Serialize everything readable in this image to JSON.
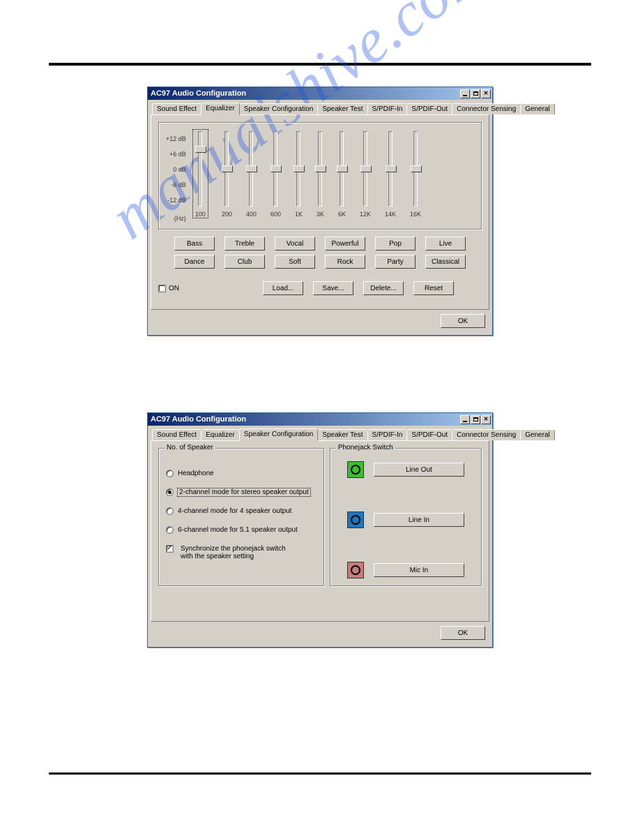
{
  "watermark": "manualshive.com",
  "window1": {
    "title": "AC97 Audio Configuration",
    "tabs": [
      "Sound Effect",
      "Equalizer",
      "Speaker Configuration",
      "Speaker Test",
      "S/PDIF-In",
      "S/PDIF-Out",
      "Connector Sensing",
      "General"
    ],
    "active_tab_index": 1,
    "eq_db_labels": [
      "+12 dB",
      "+6 dB",
      "0 dB",
      "-6 dB",
      "-12 dB"
    ],
    "eq_hz_label": "(Hz)",
    "eq_bands": [
      "100",
      "200",
      "400",
      "600",
      "1K",
      "3K",
      "6K",
      "12K",
      "14K",
      "16K"
    ],
    "presets_row1": [
      "Bass",
      "Treble",
      "Vocal",
      "Powerful",
      "Pop",
      "Live"
    ],
    "presets_row2": [
      "Dance",
      "Club",
      "Soft",
      "Rock",
      "Party",
      "Classical"
    ],
    "on_checkbox": "ON",
    "on_checked": false,
    "buttons_row3": [
      "Load...",
      "Save...",
      "Delete...",
      "Reset"
    ],
    "ok": "OK"
  },
  "window2": {
    "title": "AC97 Audio Configuration",
    "tabs": [
      "Sound Effect",
      "Equalizer",
      "Speaker Configuration",
      "Speaker Test",
      "S/PDIF-In",
      "S/PDIF-Out",
      "Connector Sensing",
      "General"
    ],
    "active_tab_index": 2,
    "group1": "No. of Speaker",
    "group2": "Phonejack Switch",
    "radios": [
      {
        "label": "Headphone",
        "checked": false
      },
      {
        "label": "2-channel mode for stereo speaker output",
        "checked": true
      },
      {
        "label": "4-channel mode for 4 speaker output",
        "checked": false
      },
      {
        "label": "6-channel mode for 5.1 speaker output",
        "checked": false
      }
    ],
    "sync_checkbox": "Synchronize the phonejack switch with the speaker setting",
    "sync_checked": true,
    "jacks": [
      {
        "color": "green",
        "label": "Line Out"
      },
      {
        "color": "blue",
        "label": "Line In"
      },
      {
        "color": "pink",
        "label": "Mic In"
      }
    ],
    "ok": "OK"
  }
}
